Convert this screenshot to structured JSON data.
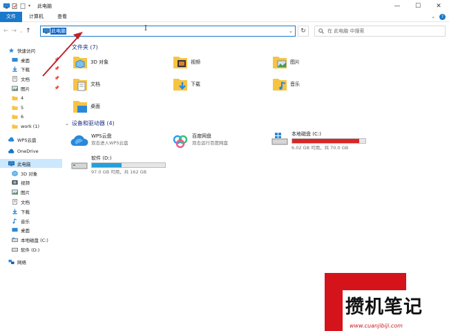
{
  "window": {
    "title": "此电脑"
  },
  "ribbon": {
    "tabs": [
      "文件",
      "计算机",
      "查看"
    ]
  },
  "address": {
    "location": "此电脑",
    "search_placeholder": "在 此电脑 中搜索"
  },
  "sidebar": {
    "quick_access": "快速访问",
    "quick_items": [
      "桌面",
      "下载",
      "文档",
      "图片",
      "4",
      "5",
      "6",
      "work (1)"
    ],
    "wps": "WPS云盘",
    "onedrive": "OneDrive",
    "this_pc": "此电脑",
    "pc_items": [
      "3D 对象",
      "视频",
      "图片",
      "文档",
      "下载",
      "音乐",
      "桌面",
      "本地磁盘 (C:)",
      "软件 (D:)"
    ],
    "network": "网络"
  },
  "main": {
    "folders_header": "文件夹 (7)",
    "folders": [
      "3D 对象",
      "视频",
      "图片",
      "文档",
      "下载",
      "音乐",
      "桌面"
    ],
    "devices_header": "设备和驱动器 (4)",
    "devices": [
      {
        "name": "WPS云盘",
        "sub": "双击进入WPS云盘"
      },
      {
        "name": "百度网盘",
        "sub": "双击运行百度网盘"
      },
      {
        "name": "本地磁盘 (C:)",
        "sub": "6.02 GB 可用，共 70.0 GB",
        "used_fraction": 0.914,
        "bar_color": "#da2626"
      },
      {
        "name": "软件 (D:)",
        "sub": "97.0 GB 可用，共 162 GB",
        "used_fraction": 0.401,
        "bar_color": "#26a0da"
      }
    ]
  },
  "watermark": {
    "text": "攒机笔记",
    "url": "www.cuanjibiji.com"
  },
  "colors": {
    "accent": "#1979ca",
    "selection": "#cce8ff",
    "arrow": "#c0222a"
  }
}
